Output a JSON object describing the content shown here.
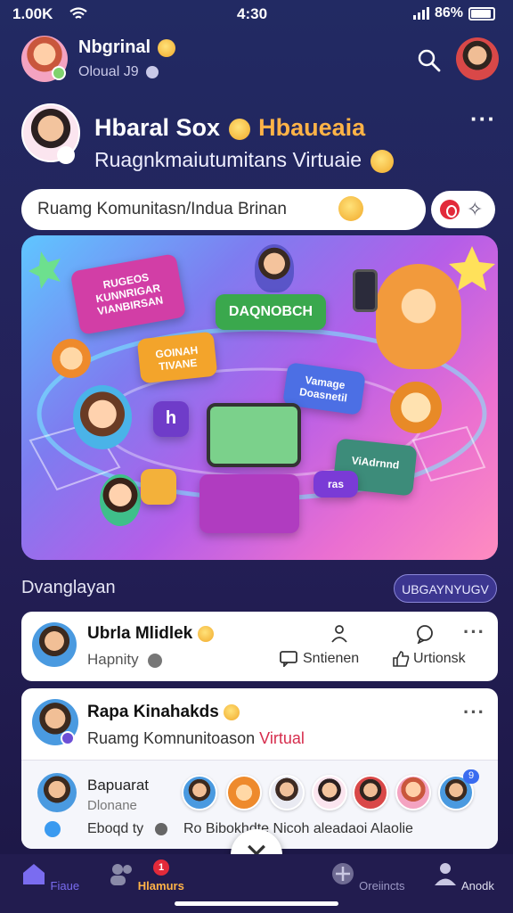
{
  "status_bar": {
    "signal_text": "1.00K",
    "time": "4:30",
    "battery": "86%"
  },
  "header": {
    "name": "Nbgrinal",
    "subtitle": "Oloual J9"
  },
  "profile": {
    "title": "Hbaral Sox",
    "title_accent": "Hbaueaia",
    "subtitle": "Ruagnkmaiutumitans Virtuaie"
  },
  "search": {
    "text": "Ruamg Komunitasn/Indua Brinan"
  },
  "banner": {
    "labels": [
      "RUGEOS KUNNRIGAR VIANBIRSAN",
      "GOINAH TIVANE",
      "DAQNOBCH",
      "Vamage Doasnetil",
      "ViAdrnnd",
      "ras"
    ]
  },
  "section": {
    "label": "Dvanglayan",
    "button": "UBGAYNYUGV"
  },
  "post1": {
    "name": "Ubrla Mlidlek",
    "sub": "Hapnity",
    "action1": "Sntienen",
    "action2": "Urtionsk"
  },
  "post2": {
    "name": "Rapa Kinahakds",
    "sub": "Ruamg Komnunitoason",
    "sub_accent": "Virtual"
  },
  "community": {
    "name": "Bapuarat",
    "sub": "Dlonane",
    "meta": "Eboqd ty",
    "names_line": "Ro Bibokhdte Nicoh aleadaoi Alaolie",
    "badge": "9"
  },
  "nav": [
    {
      "label": "Fiaue",
      "icon": "home-icon"
    },
    {
      "label": "Hlamurs",
      "icon": "people-icon",
      "badge": "1"
    },
    {
      "label": "Oreiincts",
      "icon": "compass-icon"
    },
    {
      "label": "Anodk",
      "icon": "profile-icon"
    }
  ],
  "colors": {
    "accent": "#ffb347",
    "virtual": "#d62d4d",
    "nav_active": "#ffb347",
    "bg": "#222a63"
  }
}
